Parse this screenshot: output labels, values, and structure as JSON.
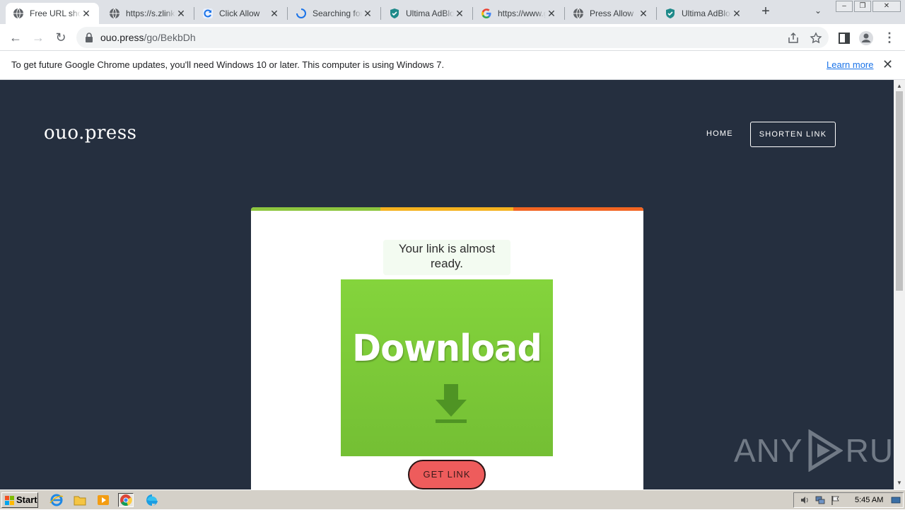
{
  "browser": {
    "tabs": [
      {
        "title": "Free URL shortener",
        "favicon": "ouo-favicon-icon",
        "active": true
      },
      {
        "title": "https://s.zlink.to",
        "favicon": "globe-icon",
        "active": false
      },
      {
        "title": "Click Allow",
        "favicon": "refresh-favicon-icon",
        "active": false
      },
      {
        "title": "Searching for Updates",
        "favicon": "loading-spinner-icon",
        "active": false
      },
      {
        "title": "Ultima AdBlocker",
        "favicon": "shield-icon",
        "active": false
      },
      {
        "title": "https://www.google.com",
        "favicon": "google-g-icon",
        "active": false
      },
      {
        "title": "Press Allow",
        "favicon": "globe-icon",
        "active": false
      },
      {
        "title": "Ultima AdBlocker",
        "favicon": "shield-icon",
        "active": false
      }
    ],
    "url_host": "ouo.press",
    "url_path": "/go/BekbDh"
  },
  "infobar": {
    "message": "To get future Google Chrome updates, you'll need Windows 10 or later. This computer is using Windows 7.",
    "link": "Learn more"
  },
  "page": {
    "logo": "ouo.press",
    "nav": {
      "home": "HOME",
      "shorten": "SHORTEN LINK"
    },
    "ready_text": "Your link is almost ready.",
    "ad_text": "Download",
    "get_link": "GET LINK",
    "accent_colors": [
      "#8dc63f",
      "#f5b21f",
      "#f26522"
    ]
  },
  "watermark": {
    "left": "ANY",
    "right": "RUN"
  },
  "taskbar": {
    "start": "Start",
    "clock": "5:45 AM"
  }
}
